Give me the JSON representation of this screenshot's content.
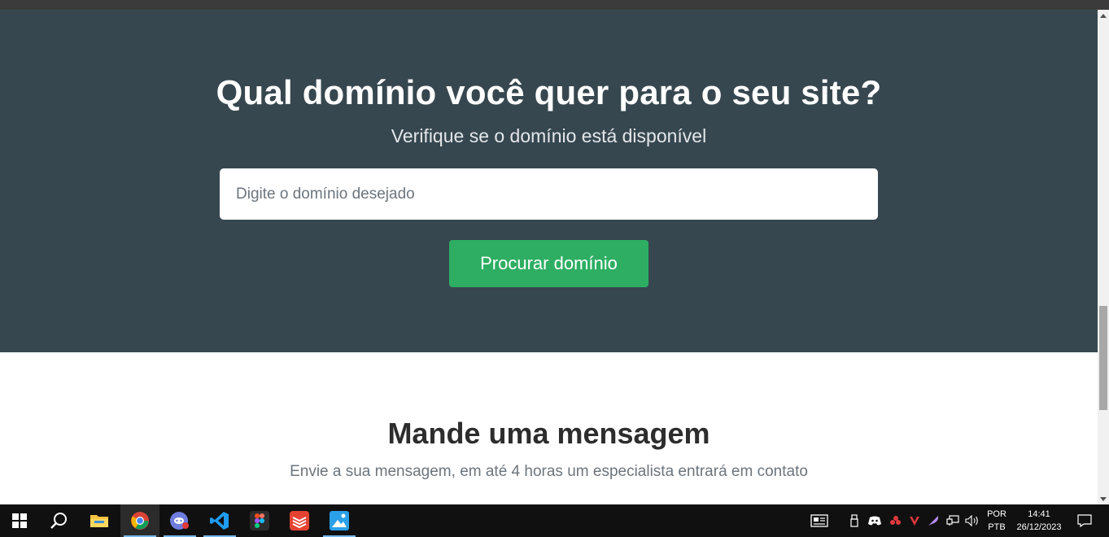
{
  "hero": {
    "title": "Qual domínio você quer para o seu site?",
    "subtitle": "Verifique se o domínio está disponível",
    "input_placeholder": "Digite o domínio desejado",
    "button_label": "Procurar domínio"
  },
  "contact": {
    "title": "Mande uma mensagem",
    "subtitle": "Envie a sua mensagem, em até 4 horas um especialista entrará em contato"
  },
  "colors": {
    "hero_bg": "#37474f",
    "button_green": "#2eae63",
    "taskbar_bg": "#101010"
  },
  "taskbar": {
    "apps": [
      "start-icon",
      "search-icon",
      "file-explorer-icon",
      "chrome-icon",
      "discord-icon",
      "vscode-icon",
      "figma-icon",
      "todoist-icon",
      "photos-icon"
    ],
    "tray": {
      "language_top": "POR",
      "language_bottom": "PTB",
      "time": "14:41",
      "date": "26/12/2023"
    }
  }
}
